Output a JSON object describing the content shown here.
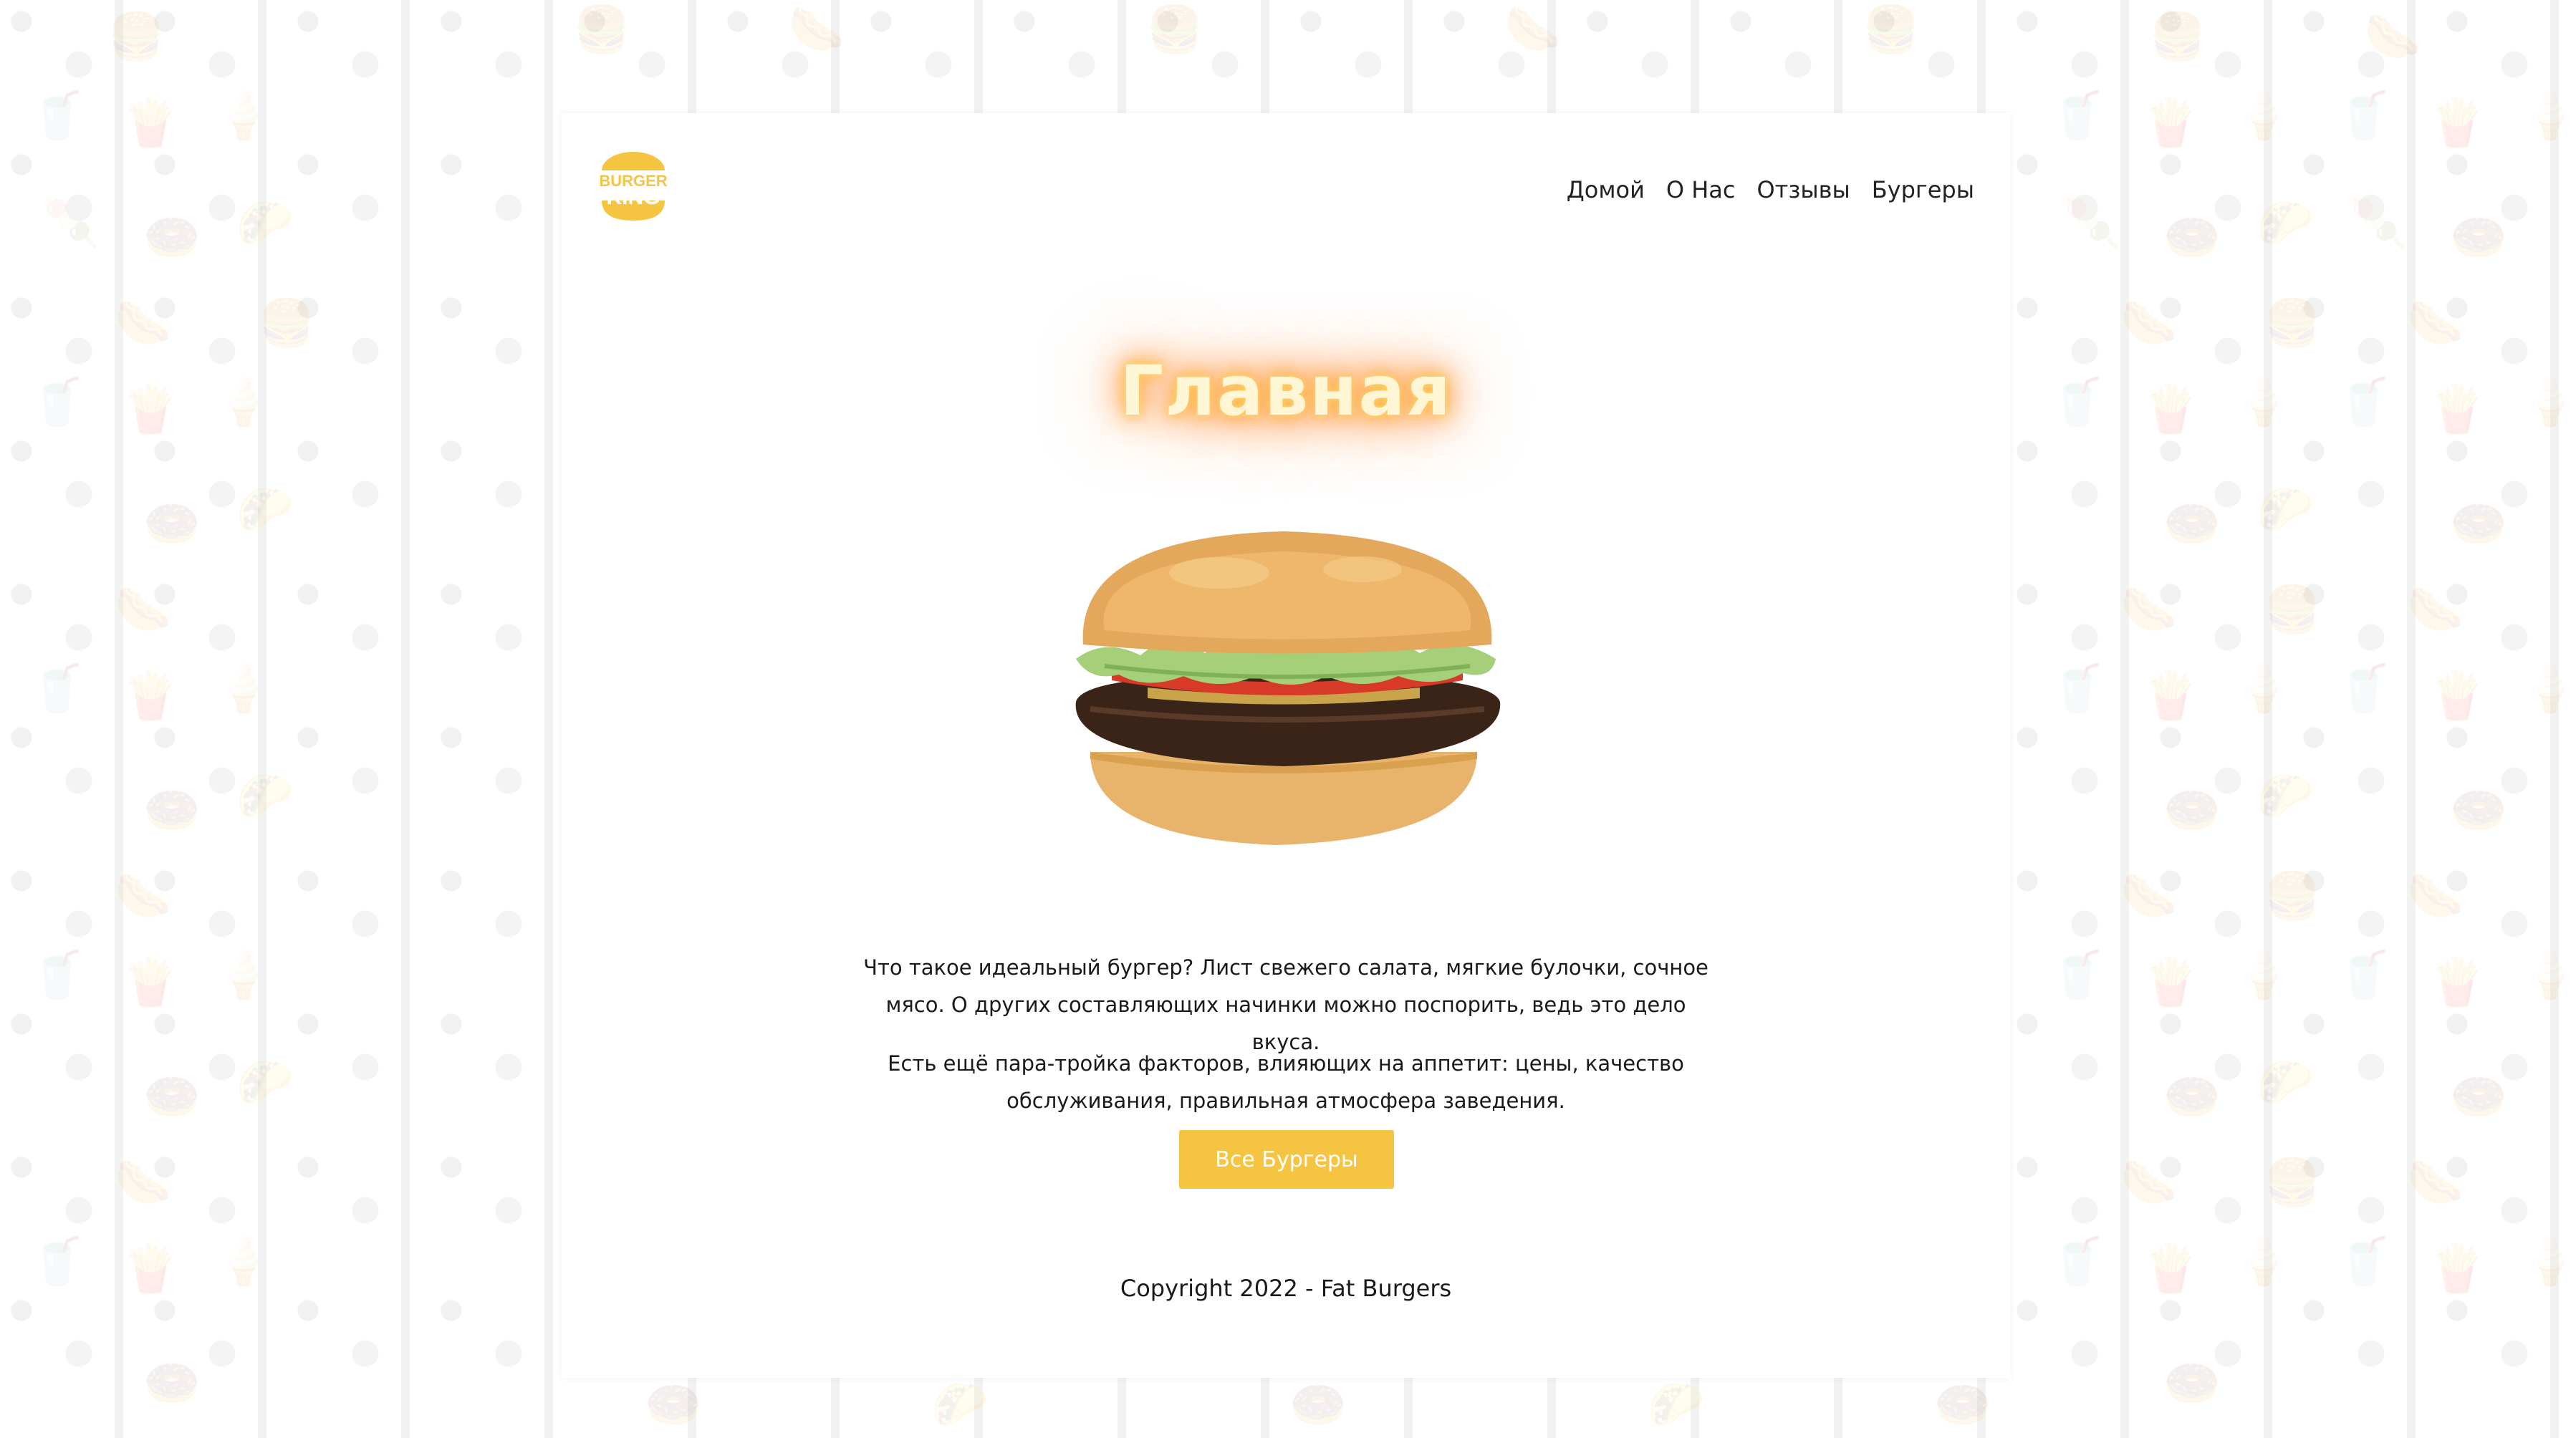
{
  "brand": {
    "logo_line1": "BURGER",
    "logo_line2": "KING",
    "logo_color": "#f5c542"
  },
  "nav": {
    "items": [
      {
        "label": "Домой"
      },
      {
        "label": "О Нас"
      },
      {
        "label": "Отзывы"
      },
      {
        "label": "Бургеры"
      }
    ]
  },
  "hero": {
    "title": "Главная",
    "image_icon": "burger-image"
  },
  "content": {
    "paragraph1": "Что такое идеальный бургер? Лист свежего салата, мягкие булочки, сочное мясо. О других составляющих начинки можно поспорить, ведь это дело вкуса.",
    "paragraph2": "Есть ещё пара-тройка факторов, влияющих на аппетит: цены, качество обслуживания, правильная атмосфера заведения."
  },
  "cta": {
    "label": "Все Бургеры",
    "color": "#f5c542"
  },
  "footer": {
    "copyright": "Copyright 2022 - Fat Burgers"
  },
  "background": {
    "pattern_icons": [
      "hamburger-icon",
      "hotdog-icon",
      "soda-cup-icon",
      "fries-icon",
      "ice-cream-icon",
      "donut-icon",
      "taco-icon",
      "popsicle-icon"
    ]
  }
}
